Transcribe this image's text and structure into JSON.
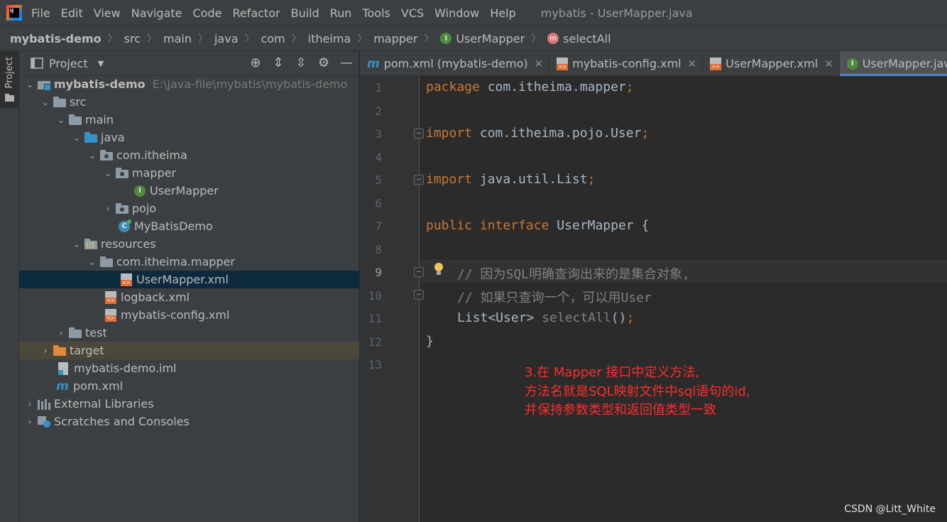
{
  "menu": {
    "items": [
      "File",
      "Edit",
      "View",
      "Navigate",
      "Code",
      "Refactor",
      "Build",
      "Run",
      "Tools",
      "VCS",
      "Window",
      "Help"
    ],
    "window_title": "mybatis - UserMapper.java"
  },
  "breadcrumb": {
    "items": [
      "mybatis-demo",
      "src",
      "main",
      "java",
      "com",
      "itheima",
      "mapper",
      "UserMapper",
      "selectAll"
    ]
  },
  "left_strip": {
    "project_label": "Project"
  },
  "project_panel": {
    "title": "Project",
    "tree": {
      "root": {
        "label": "mybatis-demo",
        "path": "E:\\java-file\\mybatis\\mybatis-demo"
      },
      "src": "src",
      "main": "main",
      "java": "java",
      "com_itheima": "com.itheima",
      "mapper": "mapper",
      "user_mapper": "UserMapper",
      "pojo": "pojo",
      "mybatis_demo_class": "MyBatisDemo",
      "resources": "resources",
      "res_mapper_pkg": "com.itheima.mapper",
      "user_mapper_xml": "UserMapper.xml",
      "logback_xml": "logback.xml",
      "mybatis_config_xml": "mybatis-config.xml",
      "test": "test",
      "target": "target",
      "iml": "mybatis-demo.iml",
      "pom": "pom.xml",
      "external_libraries": "External Libraries",
      "scratches": "Scratches and Consoles"
    }
  },
  "tabs": [
    {
      "label": "pom.xml (mybatis-demo)",
      "active": false
    },
    {
      "label": "mybatis-config.xml",
      "active": false
    },
    {
      "label": "UserMapper.xml",
      "active": false
    },
    {
      "label": "UserMapper.java",
      "active": true
    }
  ],
  "editor": {
    "line_numbers": [
      "1",
      "2",
      "3",
      "4",
      "5",
      "6",
      "7",
      "8",
      "9",
      "10",
      "11",
      "12",
      "13"
    ],
    "current_line": "9",
    "code": {
      "l1_kw": "package",
      "l1_rest": " com.itheima.mapper",
      "l1_semi": ";",
      "l3_kw": "import",
      "l3_rest": " com.itheima.pojo.User",
      "l3_semi": ";",
      "l5_kw": "import",
      "l5_rest": " java.util.List",
      "l5_semi": ";",
      "l7_kw1": "public",
      "l7_kw2": "interface",
      "l7_rest": " UserMapper {",
      "l9_comment": "// 因为SQL明确查询出来的是集合对象,",
      "l10_comment": "// 如果只查询一个，可以用User",
      "l11_type": "List<User> ",
      "l11_fn": "selectAll",
      "l11_paren": "()",
      "l11_semi": ";",
      "l12": "}"
    },
    "annotation": {
      "line1": "3.在 Mapper 接口中定义方法,",
      "line2": "方法名就是SQL映射文件中sql语句的id,",
      "line3": "并保持参数类型和返回值类型一致"
    },
    "watermark": "CSDN @Litt_White"
  },
  "colors": {
    "keyword": "#cc7832",
    "comment": "#808080",
    "annotation": "#ff2b2b",
    "selection": "#0d293e",
    "tab_accent": "#4a88c7"
  }
}
